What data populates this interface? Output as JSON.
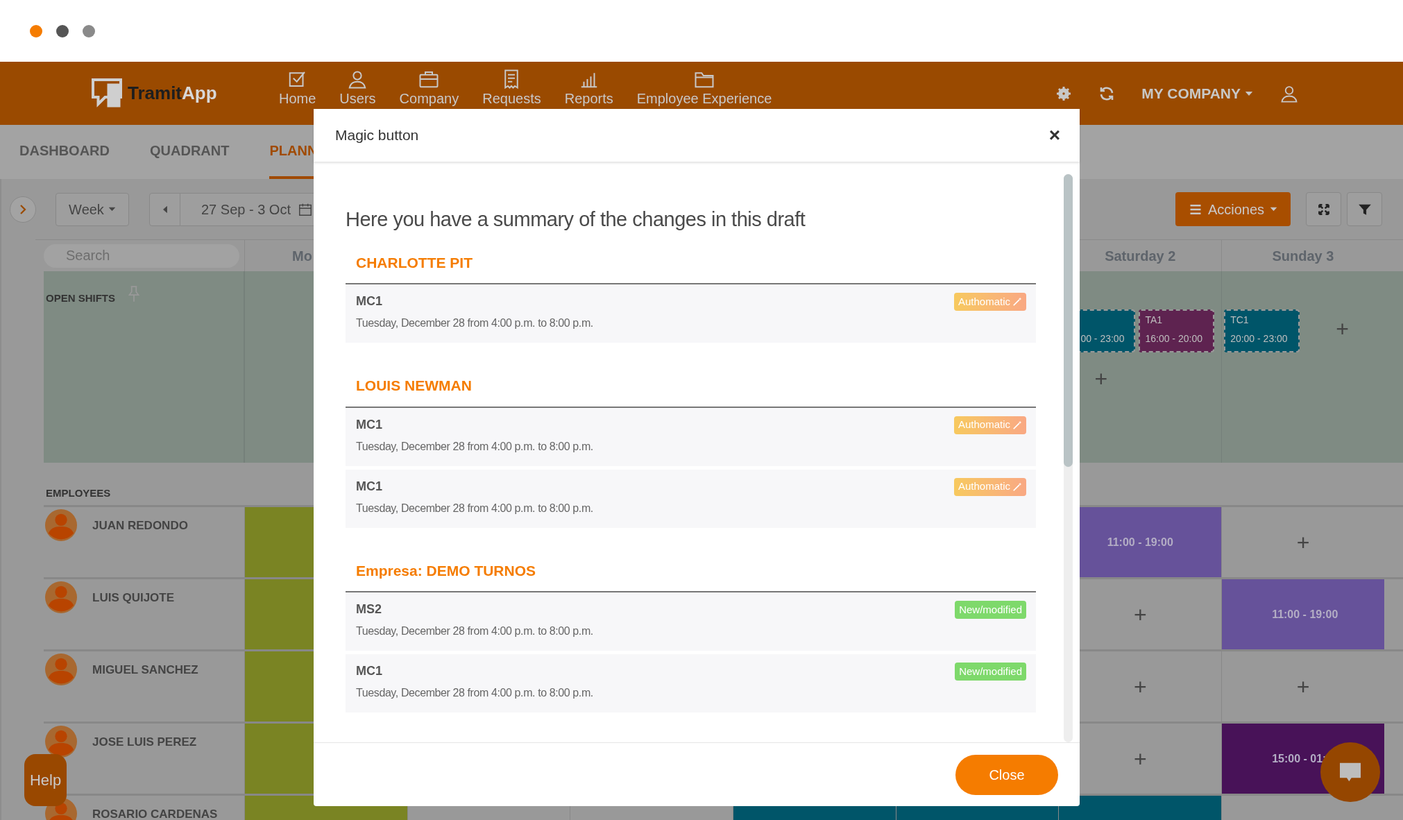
{
  "window_controls": [
    {
      "color": "#f57c00"
    },
    {
      "color": "#555555"
    },
    {
      "color": "#8a8a8a"
    }
  ],
  "navbar": {
    "logo": {
      "part1": "Tramit",
      "part2": "App"
    },
    "items": [
      {
        "label": "Home"
      },
      {
        "label": "Users"
      },
      {
        "label": "Company"
      },
      {
        "label": "Requests"
      },
      {
        "label": "Reports"
      },
      {
        "label": "Employee Experience"
      }
    ],
    "company": "MY COMPANY"
  },
  "tabs": [
    {
      "label": "DASHBOARD",
      "selected": false
    },
    {
      "label": "QUADRANT",
      "selected": false
    },
    {
      "label": "PLANN",
      "selected": true
    }
  ],
  "toolbar": {
    "view": "Week",
    "date_range": "27 Sep - 3 Oct",
    "actions": "Acciones"
  },
  "schedule": {
    "search": {
      "placeholder": "Search"
    },
    "columns": [
      "Mo",
      "Saturday 2",
      "Sunday 3"
    ],
    "open_shifts": {
      "label": "OPEN SHIFTS",
      "saturday": [
        {
          "time": "00 - 23:00",
          "color": "#005569"
        },
        {
          "code": "TA1",
          "time": "16:00 - 20:00",
          "color": "#5e2350"
        }
      ],
      "saturday_add": "+",
      "sunday": [
        {
          "code": "TC1",
          "time": "20:00 - 23:00",
          "color": "#005569"
        }
      ],
      "sunday_add": "+"
    },
    "employees_label": "EMPLOYEES",
    "employees": [
      {
        "name": "JUAN REDONDO",
        "cells": [
          {
            "kind": "shift",
            "color": "#7a8423"
          },
          null,
          null,
          null,
          null,
          {
            "kind": "shift",
            "color": "#66529a",
            "time": "11:00 - 19:00"
          },
          {
            "kind": "add",
            "label": "+"
          }
        ]
      },
      {
        "name": "LUIS QUIJOTE",
        "cells": [
          {
            "kind": "shift",
            "color": "#7a8423"
          },
          null,
          null,
          null,
          null,
          {
            "kind": "add",
            "label": "+"
          },
          {
            "kind": "shift",
            "color": "#66529a",
            "time": "11:00 - 19:00"
          }
        ]
      },
      {
        "name": "MIGUEL SANCHEZ",
        "cells": [
          {
            "kind": "shift",
            "color": "#7a8423"
          },
          null,
          null,
          null,
          null,
          {
            "kind": "add",
            "label": "+"
          },
          {
            "kind": "add",
            "label": "+"
          }
        ]
      },
      {
        "name": "JOSE LUIS PEREZ",
        "cells": [
          {
            "kind": "shift",
            "color": "#7a8423"
          },
          null,
          null,
          null,
          null,
          {
            "kind": "add",
            "label": "+"
          },
          {
            "kind": "shift",
            "color": "#481258",
            "time": "15:00 - 01:"
          }
        ]
      },
      {
        "name": "ROSARIO CARDENAS",
        "cells": [
          {
            "kind": "shift",
            "color": "#7a8423"
          },
          {
            "kind": "empty"
          },
          {
            "kind": "empty"
          },
          {
            "kind": "shift",
            "color": "#005569"
          },
          {
            "kind": "shift",
            "color": "#005569"
          },
          {
            "kind": "shift",
            "color": "#005569"
          },
          {
            "kind": "empty"
          }
        ]
      }
    ]
  },
  "help": "Help",
  "modal": {
    "title": "Magic button",
    "close_icon": "×",
    "heading": "Here you have a summary of the changes in this draft",
    "groups": [
      {
        "name": "CHARLOTTE PIT",
        "items": [
          {
            "code": "MC1",
            "description": "Tuesday, December 28 from 4:00 p.m. to 8:00 p.m.",
            "kind": "automatic",
            "badge": "Authomatic"
          }
        ]
      },
      {
        "name": "LOUIS NEWMAN",
        "items": [
          {
            "code": "MC1",
            "description": "Tuesday, December 28 from 4:00 p.m. to 8:00 p.m.",
            "kind": "automatic",
            "badge": "Authomatic"
          },
          {
            "code": "MC1",
            "description": "Tuesday, December 28 from 4:00 p.m. to 8:00 p.m.",
            "kind": "automatic",
            "badge": "Authomatic"
          }
        ]
      },
      {
        "name": "Empresa: DEMO TURNOS",
        "items": [
          {
            "code": "MS2",
            "description": "Tuesday, December 28 from 4:00 p.m. to 8:00 p.m.",
            "kind": "new",
            "badge": "New/modified"
          },
          {
            "code": "MC1",
            "description": "Tuesday, December 28 from 4:00 p.m. to 8:00 p.m.",
            "kind": "new",
            "badge": "New/modified"
          }
        ]
      }
    ],
    "close_button": "Close"
  }
}
